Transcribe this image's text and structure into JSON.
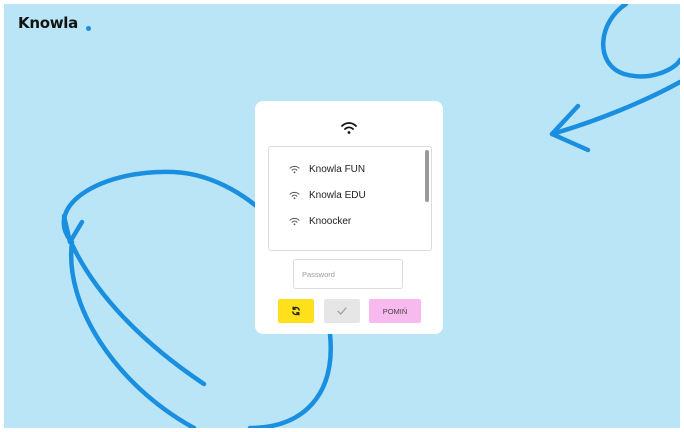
{
  "brand": {
    "name": "Knowla",
    "dot_color": "#1a8fe0"
  },
  "colors": {
    "background": "#b9e5f7",
    "doodle": "#1a8fe0",
    "refresh_button": "#ffe01b",
    "confirm_button": "#e6e6e6",
    "skip_button": "#f8b9ee"
  },
  "wifi_panel": {
    "header_icon": "wifi-icon",
    "networks": [
      {
        "label": "Knowla FUN",
        "icon": "wifi-icon"
      },
      {
        "label": "Knowla EDU",
        "icon": "wifi-icon"
      },
      {
        "label": "Knoocker",
        "icon": "wifi-icon"
      }
    ],
    "password": {
      "placeholder": "Password",
      "value": ""
    },
    "buttons": {
      "refresh_icon": "refresh-icon",
      "confirm_icon": "checkmark-icon",
      "skip_label": "POMIŃ"
    }
  }
}
